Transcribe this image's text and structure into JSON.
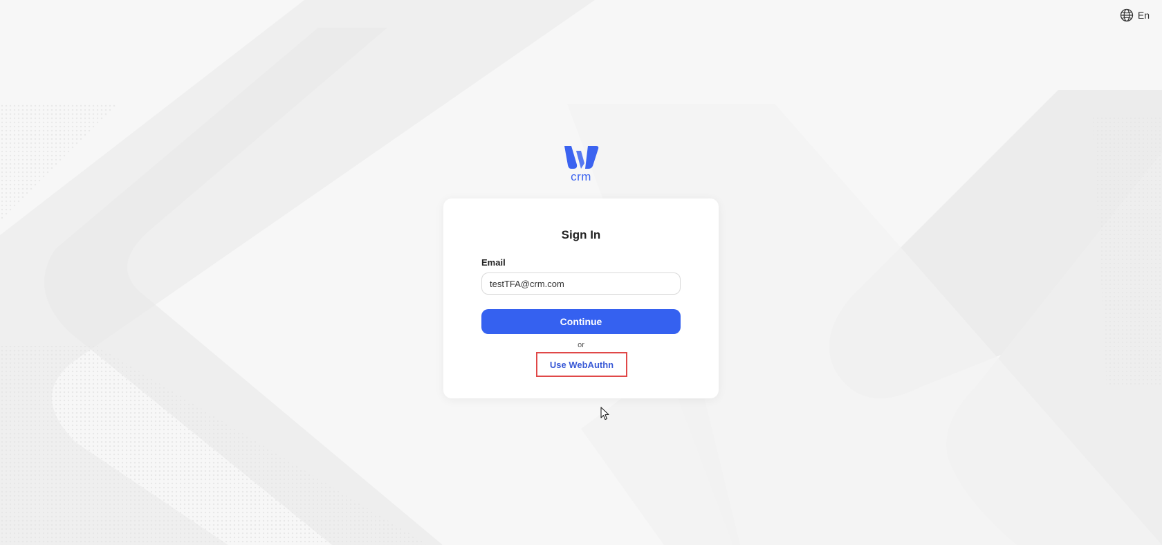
{
  "language": {
    "label": "En",
    "icon": "globe-icon"
  },
  "brand": {
    "logo_icon": "w-logo-icon",
    "name": "crm",
    "color": "#3b63f0"
  },
  "signin": {
    "title": "Sign In",
    "email_label": "Email",
    "email_value": "testTFA@crm.com",
    "email_placeholder": "",
    "continue_label": "Continue",
    "or_label": "or",
    "webauthn_label": "Use WebAuthn"
  },
  "colors": {
    "primary": "#3561f0",
    "highlight_border": "#e04848",
    "link": "#3a5ad6",
    "background": "#f6f6f6"
  }
}
